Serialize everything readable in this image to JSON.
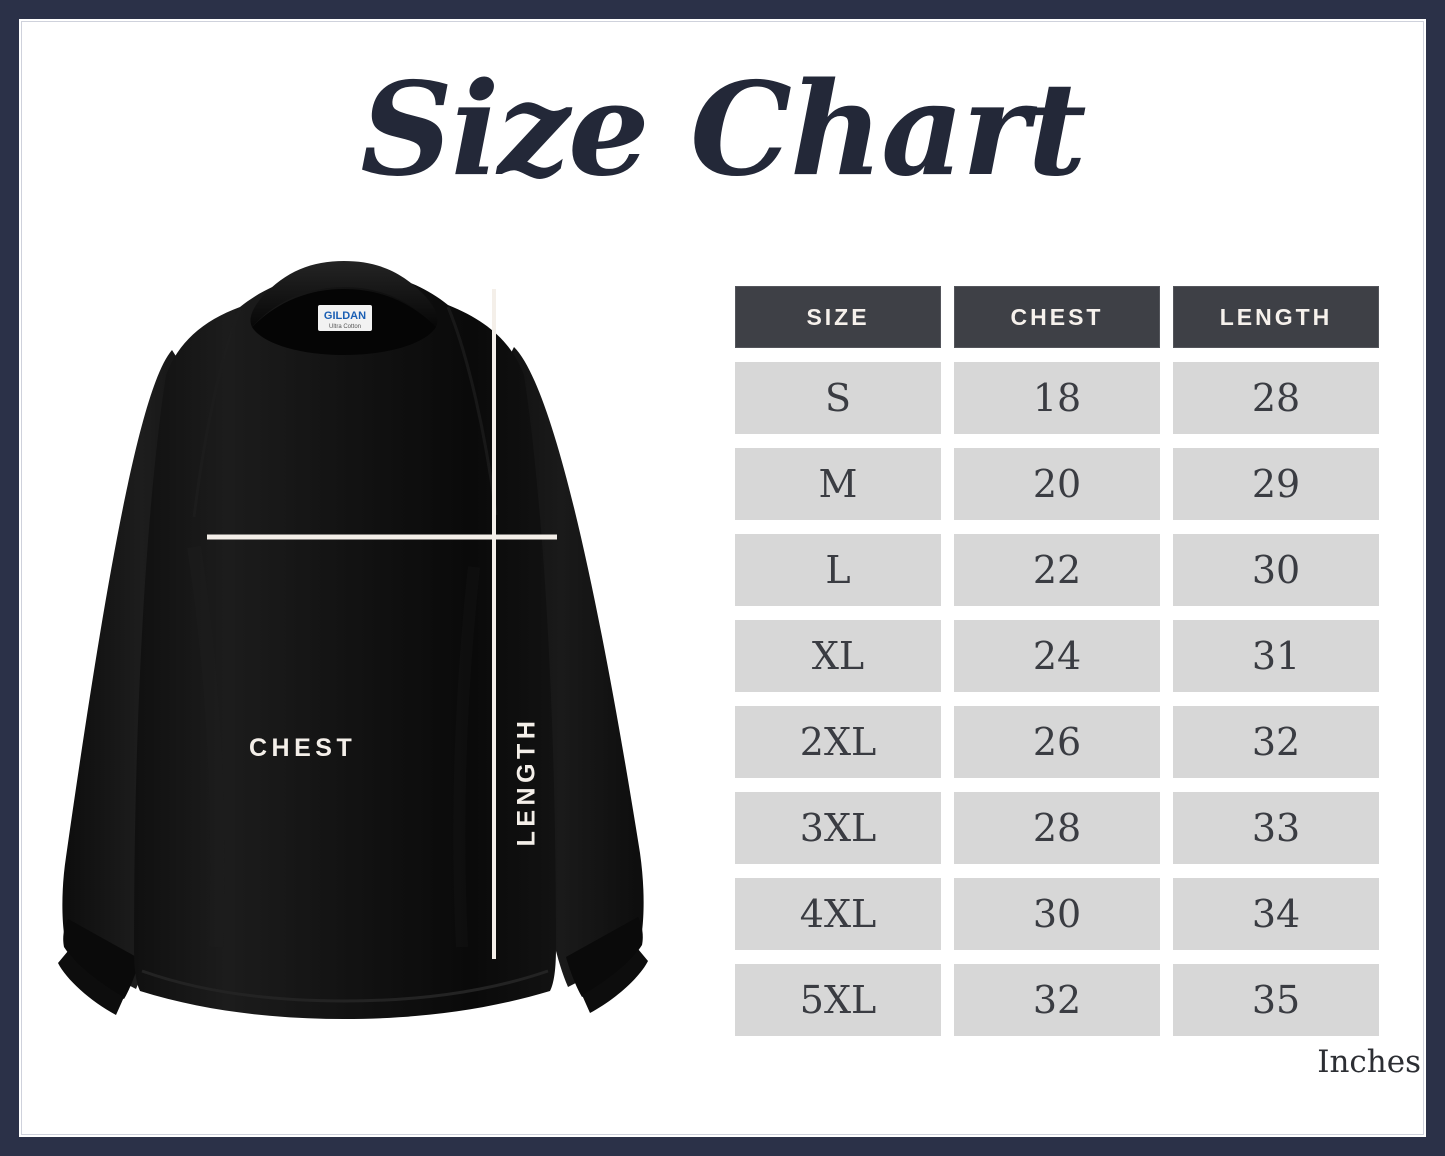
{
  "frame": {
    "border_color": "#2b3148",
    "background": "#ffffff"
  },
  "header": {
    "title": "Size Chart"
  },
  "product_image": {
    "garment": "long-sleeve-tee",
    "color": "#0b0b0b",
    "brand_label": {
      "name": "GILDAN",
      "sub": "Ultra Cotton",
      "name_color": "#1a5fb4",
      "tag_color": "#f2f2f2"
    },
    "measurement_lines": {
      "chest_label": "CHEST",
      "length_label": "LENGTH",
      "line_color": "#f4efe9"
    }
  },
  "table": {
    "accent_header_color": "#3e4046",
    "cell_color": "#d7d7d7",
    "columns": [
      "SIZE",
      "CHEST",
      "LENGTH"
    ],
    "rows": [
      {
        "size": "S",
        "chest": "18",
        "length": "28"
      },
      {
        "size": "M",
        "chest": "20",
        "length": "29"
      },
      {
        "size": "L",
        "chest": "22",
        "length": "30"
      },
      {
        "size": "XL",
        "chest": "24",
        "length": "31"
      },
      {
        "size": "2XL",
        "chest": "26",
        "length": "32"
      },
      {
        "size": "3XL",
        "chest": "28",
        "length": "33"
      },
      {
        "size": "4XL",
        "chest": "30",
        "length": "34"
      },
      {
        "size": "5XL",
        "chest": "32",
        "length": "35"
      }
    ],
    "units_label": "Inches"
  },
  "chart_data": {
    "type": "table",
    "title": "Size Chart",
    "columns": [
      "SIZE",
      "CHEST",
      "LENGTH"
    ],
    "units": "Inches",
    "categories": [
      "S",
      "M",
      "L",
      "XL",
      "2XL",
      "3XL",
      "4XL",
      "5XL"
    ],
    "series": [
      {
        "name": "CHEST",
        "values": [
          18,
          20,
          22,
          24,
          26,
          28,
          30,
          32
        ]
      },
      {
        "name": "LENGTH",
        "values": [
          28,
          29,
          30,
          31,
          32,
          33,
          34,
          35
        ]
      }
    ]
  }
}
